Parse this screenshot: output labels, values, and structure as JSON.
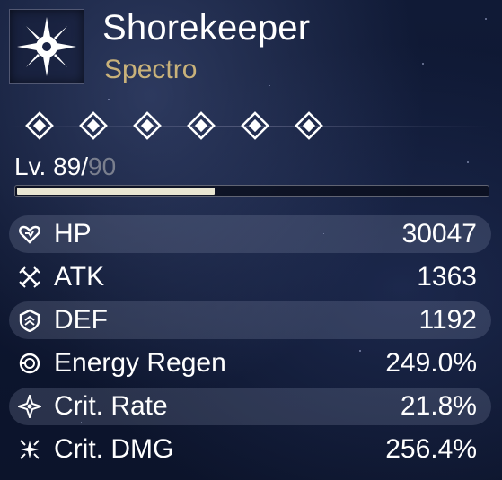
{
  "character": {
    "name": "Shorekeeper",
    "element": "Spectro",
    "emblem_icon": "spectro-sun-icon",
    "element_color": "#c9b27a"
  },
  "resonance_chain": {
    "nodes": 6,
    "icon": "diamond-icon"
  },
  "level": {
    "prefix": "Lv.",
    "current": "89",
    "separator": "/",
    "max": "90",
    "progress_fraction": 0.42
  },
  "stats": [
    {
      "label": "HP",
      "value": "30047",
      "icon": "hp-heart-icon"
    },
    {
      "label": "ATK",
      "value": "1363",
      "icon": "atk-swords-icon"
    },
    {
      "label": "DEF",
      "value": "1192",
      "icon": "def-shield-icon"
    },
    {
      "label": "Energy Regen",
      "value": "249.0%",
      "icon": "energy-regen-icon"
    },
    {
      "label": "Crit. Rate",
      "value": "21.8%",
      "icon": "crit-rate-icon"
    },
    {
      "label": "Crit. DMG",
      "value": "256.4%",
      "icon": "crit-dmg-icon"
    }
  ]
}
